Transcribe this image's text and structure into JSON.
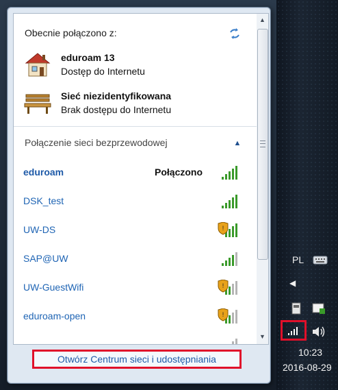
{
  "header": {
    "title": "Obecnie połączono z:",
    "refresh_icon": "refresh-icon"
  },
  "current_connections": [
    {
      "name": "eduroam  13",
      "status": "Dostęp do Internetu",
      "icon": "house-icon"
    },
    {
      "name": "Sieć niezidentyfikowana",
      "status": "Brak dostępu do Internetu",
      "icon": "bench-icon"
    }
  ],
  "wireless": {
    "section_label": "Połączenie sieci bezprzewodowej",
    "networks": [
      {
        "name": "eduroam",
        "status": "Połączono",
        "secured": false,
        "connected": true
      },
      {
        "name": "DSK_test",
        "status": "",
        "secured": false,
        "connected": false
      },
      {
        "name": "UW-DS",
        "status": "",
        "secured": true,
        "connected": false
      },
      {
        "name": "SAP@UW",
        "status": "",
        "secured": false,
        "connected": false
      },
      {
        "name": "UW-GuestWifi",
        "status": "",
        "secured": true,
        "connected": false
      },
      {
        "name": "eduroam-open",
        "status": "",
        "secured": true,
        "connected": false
      }
    ]
  },
  "footer": {
    "link_label": "Otwórz Centrum sieci i udostępniania"
  },
  "tray": {
    "language": "PL",
    "time": "10:23",
    "date": "2016-08-29"
  },
  "colors": {
    "highlight": "#e0102a",
    "link": "#1e5aa8",
    "signal": "#3a9a2a"
  }
}
